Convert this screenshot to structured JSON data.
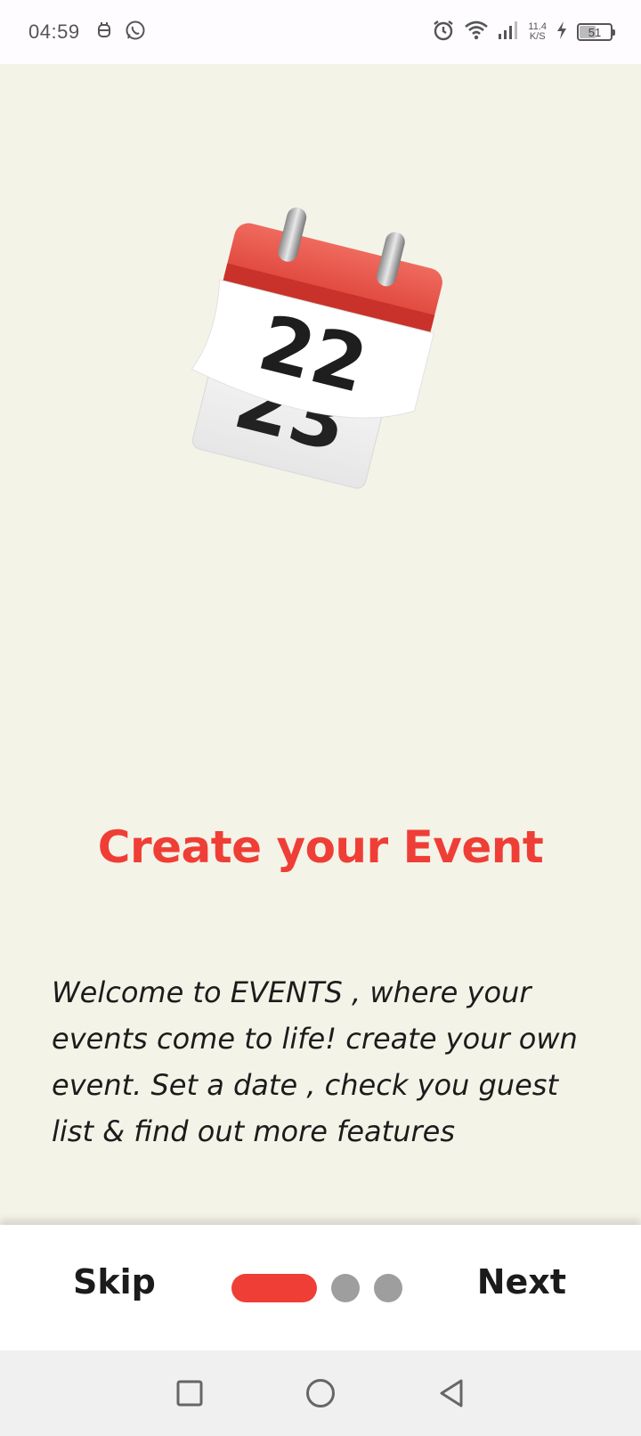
{
  "status_bar": {
    "time": "04:59",
    "net_speed_value": "11.4",
    "net_speed_unit": "K/S",
    "battery_level": "51"
  },
  "onboarding": {
    "title": "Create your Event",
    "description": "Welcome to EVENTS , where your events come to life! create your own event. Set a date , check you guest list & find out more features",
    "illustration_icon": "calendar-icon",
    "calendar_day": "22",
    "current_page": 1,
    "total_pages": 3
  },
  "footer": {
    "skip_label": "Skip",
    "next_label": "Next"
  },
  "colors": {
    "accent": "#ef3e36",
    "background": "#f4f3e8",
    "inactive_dot": "#9e9e9e"
  }
}
